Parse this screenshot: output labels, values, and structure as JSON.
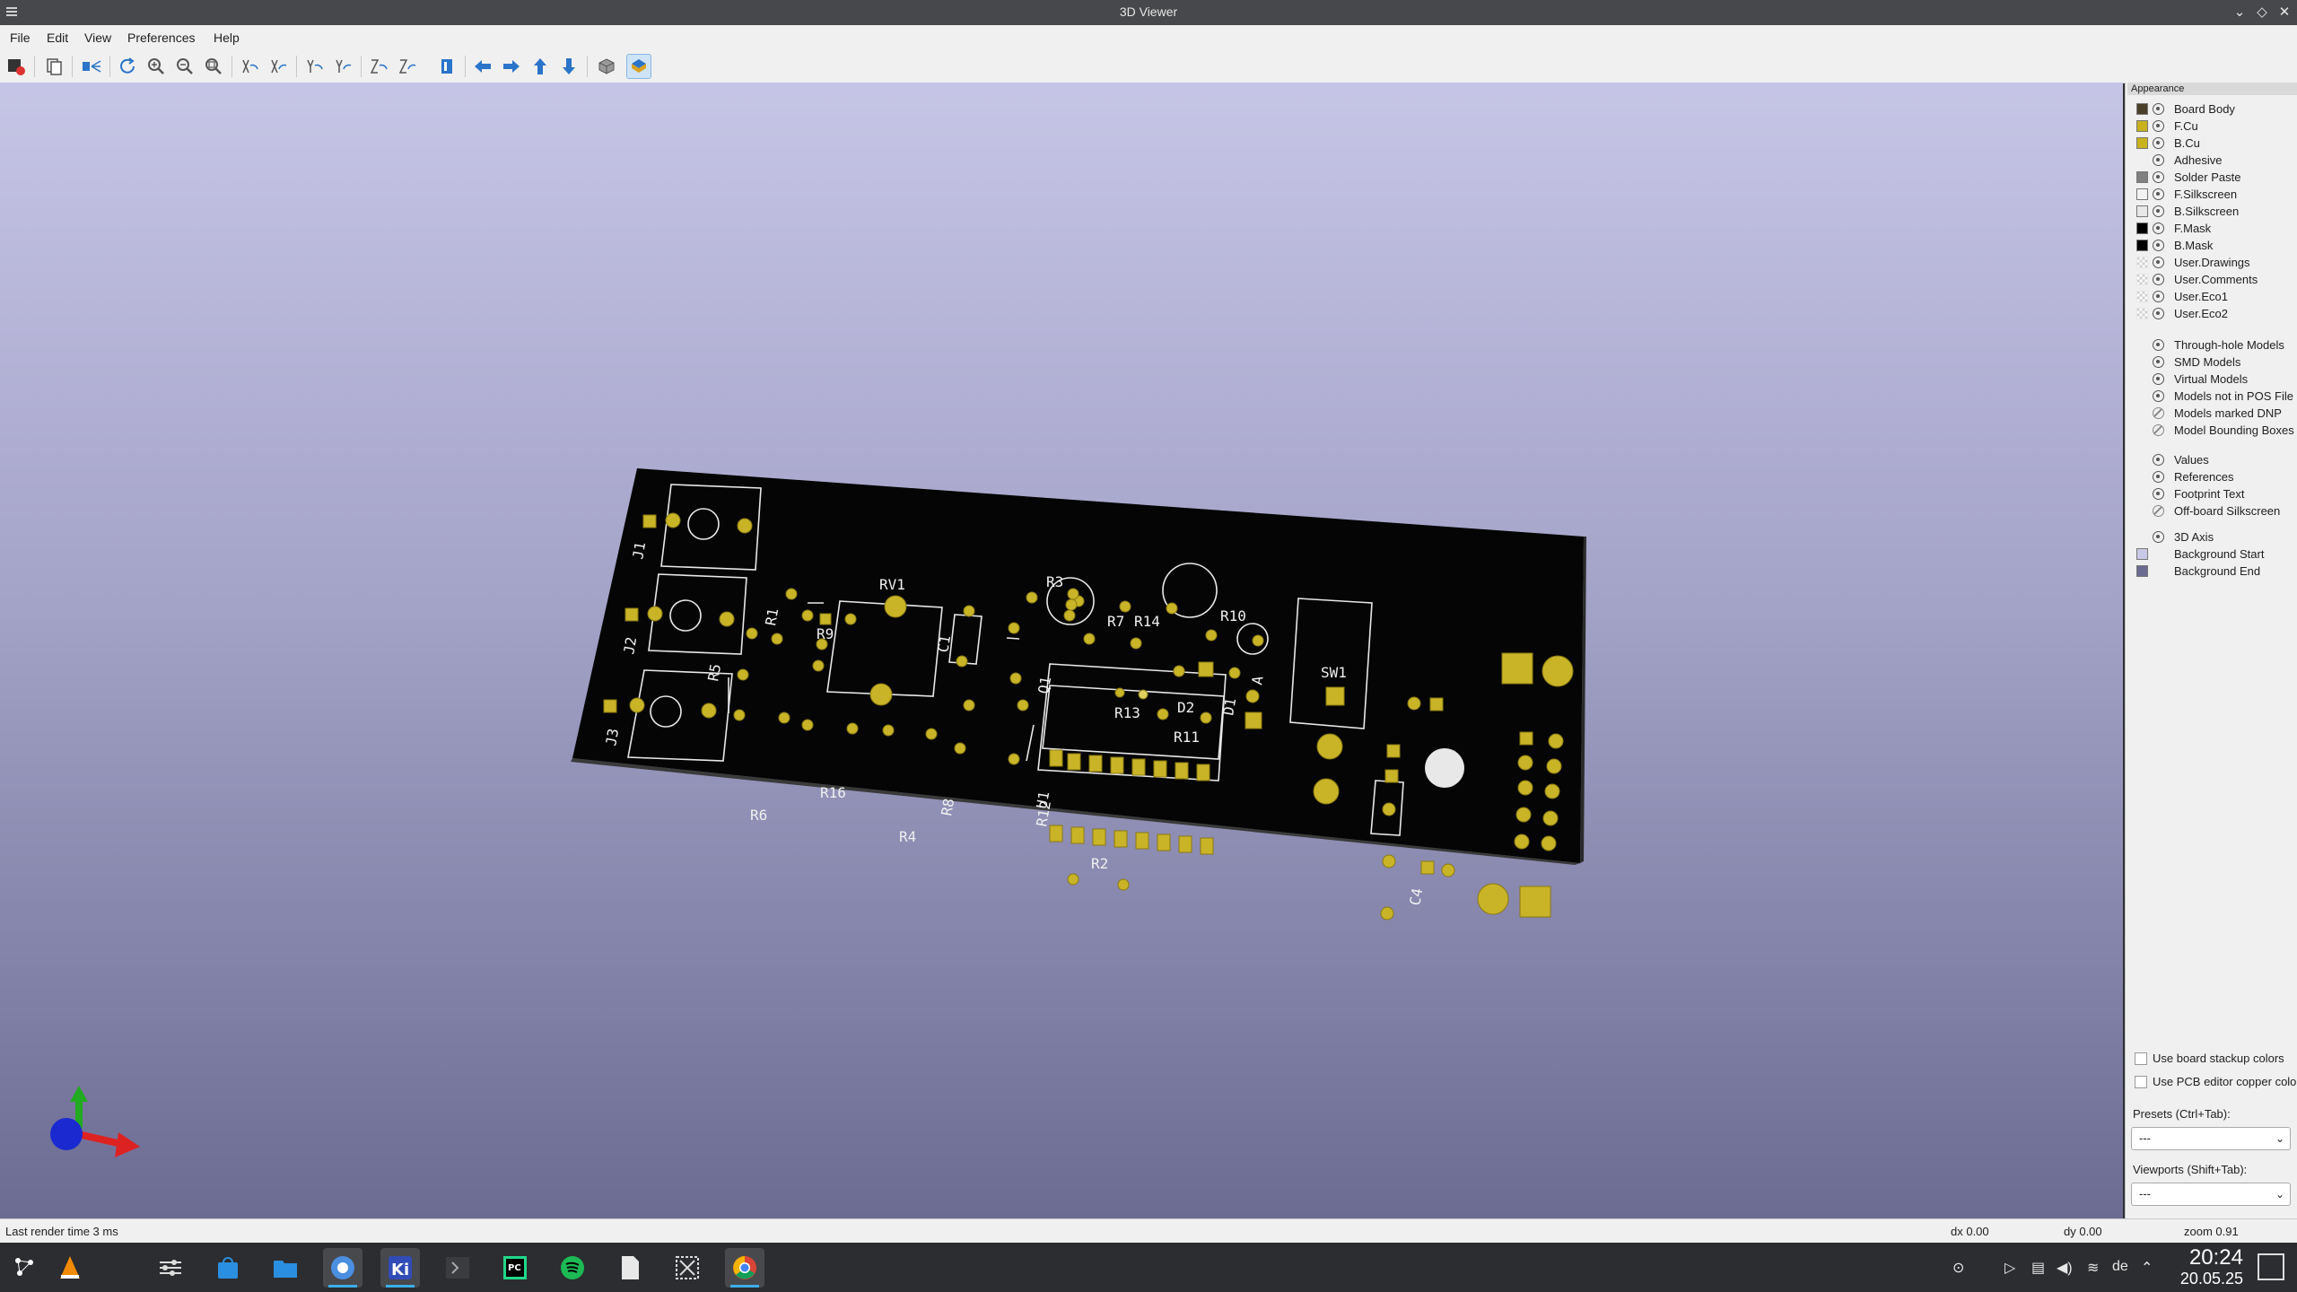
{
  "window": {
    "title": "3D Viewer"
  },
  "menu": [
    "File",
    "Edit",
    "View",
    "Preferences",
    "Help"
  ],
  "toolbar": {
    "icons": [
      "render-raytrace-icon",
      "copy-image-icon",
      "flip-board-icon",
      "reload-icon",
      "zoom-in-icon",
      "zoom-out-icon",
      "zoom-fit-icon",
      "rotate-x-cw-icon",
      "rotate-x-ccw-icon",
      "rotate-y-cw-icon",
      "rotate-y-ccw-icon",
      "rotate-z-cw-icon",
      "rotate-z-ccw-icon",
      "move-left-icon",
      "move-right-icon",
      "move-up-icon",
      "move-down-icon",
      "ortho-projection-icon",
      "show-board-icon"
    ]
  },
  "appearance": {
    "header": "Appearance",
    "layers": [
      {
        "name": "Board Body",
        "color": "#4a3f2a",
        "visible": true
      },
      {
        "name": "F.Cu",
        "color": "#c8b21e",
        "visible": true
      },
      {
        "name": "B.Cu",
        "color": "#c8b21e",
        "visible": true
      },
      {
        "name": "Adhesive",
        "color": "",
        "visible": true
      },
      {
        "name": "Solder Paste",
        "color": "#808080",
        "visible": true
      },
      {
        "name": "F.Silkscreen",
        "color": "#f2f2f2",
        "visible": true
      },
      {
        "name": "B.Silkscreen",
        "color": "#e8e8e8",
        "visible": true
      },
      {
        "name": "F.Mask",
        "color": "#000000",
        "visible": true
      },
      {
        "name": "B.Mask",
        "color": "#000000",
        "visible": true
      },
      {
        "name": "User.Drawings",
        "color": "checker",
        "visible": true
      },
      {
        "name": "User.Comments",
        "color": "checker",
        "visible": true
      },
      {
        "name": "User.Eco1",
        "color": "checker",
        "visible": true
      },
      {
        "name": "User.Eco2",
        "color": "checker",
        "visible": true
      }
    ],
    "models": [
      {
        "name": "Through-hole Models",
        "visible": true
      },
      {
        "name": "SMD Models",
        "visible": true
      },
      {
        "name": "Virtual Models",
        "visible": true
      },
      {
        "name": "Models not in POS File",
        "visible": true
      },
      {
        "name": "Models marked DNP",
        "visible": false
      },
      {
        "name": "Model Bounding Boxes",
        "visible": false
      }
    ],
    "text": [
      {
        "name": "Values",
        "visible": true
      },
      {
        "name": "References",
        "visible": true
      },
      {
        "name": "Footprint Text",
        "visible": true
      },
      {
        "name": "Off-board Silkscreen",
        "visible": false
      }
    ],
    "misc": [
      {
        "name": "3D Axis",
        "visible": true,
        "color": ""
      },
      {
        "name": "Background Start",
        "color": "#c8c8e8"
      },
      {
        "name": "Background End",
        "color": "#6b6a90"
      }
    ],
    "use_stackup_colors": "Use board stackup colors",
    "use_pcb_copper": "Use PCB editor copper color",
    "presets_label": "Presets (Ctrl+Tab):",
    "presets_value": "---",
    "viewports_label": "Viewports (Shift+Tab):",
    "viewports_value": "---"
  },
  "board": {
    "refs": [
      "J1",
      "J2",
      "J3",
      "R9",
      "RV1",
      "R1",
      "R5",
      "C1",
      "R16",
      "R6",
      "R4",
      "R8",
      "R3",
      "R7",
      "R14",
      "R10",
      "Q1",
      "D2",
      "R13",
      "R11",
      "D1",
      "A",
      "U1",
      "R12",
      "R2",
      "SW1",
      "C4"
    ]
  },
  "status": {
    "render": "Last render time 3 ms",
    "dx": "dx 0.00",
    "dy": "dy 0.00",
    "zoom": "zoom 0.91"
  },
  "taskbar": {
    "apps": [
      "app-launcher-icon",
      "vlc-icon",
      "settings-icon",
      "discover-icon",
      "files-icon",
      "chromium-icon",
      "kicad-icon",
      "terminal-icon",
      "pycharm-icon",
      "spotify-icon",
      "text-editor-icon",
      "screenshot-icon",
      "chrome-icon"
    ],
    "keyboard": "de",
    "time": "20:24",
    "date": "20.05.25"
  }
}
